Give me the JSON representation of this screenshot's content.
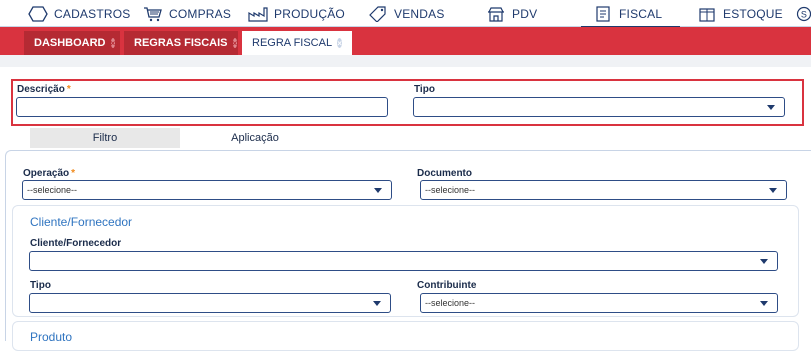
{
  "nav": {
    "items": [
      {
        "label": "CADASTROS",
        "icon": "hexagon-icon"
      },
      {
        "label": "COMPRAS",
        "icon": "cart-icon"
      },
      {
        "label": "PRODUÇÃO",
        "icon": "factory-icon"
      },
      {
        "label": "VENDAS",
        "icon": "tag-icon"
      },
      {
        "label": "PDV",
        "icon": "store-icon"
      },
      {
        "label": "FISCAL",
        "icon": "document-icon"
      },
      {
        "label": "ESTOQUE",
        "icon": "box-icon"
      },
      {
        "label": "S",
        "icon": "dollar-icon"
      }
    ],
    "active": "FISCAL"
  },
  "tabs": [
    {
      "label": "DASHBOARD"
    },
    {
      "label": "REGRAS FISCAIS"
    },
    {
      "label": "REGRA FISCAL"
    }
  ],
  "form": {
    "descricao_label": "Descrição",
    "descricao_value": "",
    "tipo_label": "Tipo",
    "tipo_value": "",
    "required_mark": "*"
  },
  "filter_tabs": [
    {
      "label": "Filtro",
      "active": true
    },
    {
      "label": "Aplicação",
      "active": false
    }
  ],
  "filter": {
    "operacao_label": "Operação",
    "operacao_value": "--selecione--",
    "documento_label": "Documento",
    "documento_value": "--selecione--",
    "cliente_section": "Cliente/Fornecedor",
    "cliente_label": "Cliente/Fornecedor",
    "cliente_value": "",
    "tipo_label": "Tipo",
    "tipo_value": "",
    "contribuinte_label": "Contribuinte",
    "contribuinte_value": "--selecione--",
    "produto_section": "Produto"
  },
  "colors": {
    "brand_red": "#d9333f",
    "navy": "#1f3a6d",
    "required_orange": "#f08a1c",
    "section_blue": "#2f74c0"
  }
}
